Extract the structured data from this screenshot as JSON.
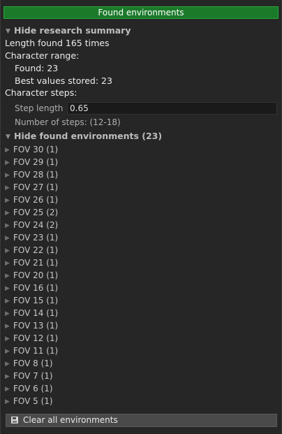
{
  "title": "Found environments",
  "research_summary": {
    "toggle_label": "Hide research summary",
    "length_found": "Length found 165 times",
    "character_range_label": "Character range:",
    "found": "Found: 23",
    "best_values": "Best values stored: 23",
    "character_steps_label": "Character steps:",
    "step_length_label": "Step length",
    "step_length_value": "0.65",
    "number_of_steps": "Number of steps:  (12-18)"
  },
  "environments": {
    "toggle_label": "Hide found environments (23)",
    "items": [
      "FOV 30 (1)",
      "FOV 29 (1)",
      "FOV 28 (1)",
      "FOV 27 (1)",
      "FOV 26 (1)",
      "FOV 25 (2)",
      "FOV 24 (2)",
      "FOV 23 (1)",
      "FOV 22 (1)",
      "FOV 21 (1)",
      "FOV 20 (1)",
      "FOV 16 (1)",
      "FOV 15 (1)",
      "FOV 14 (1)",
      "FOV 13 (1)",
      "FOV 12 (1)",
      "FOV 11 (1)",
      "FOV 8 (1)",
      "FOV 7 (1)",
      "FOV 6 (1)",
      "FOV 5 (1)"
    ]
  },
  "clear_button_label": "Clear all environments",
  "colors": {
    "title_bar": "#1b7a2a",
    "background": "#262626"
  }
}
